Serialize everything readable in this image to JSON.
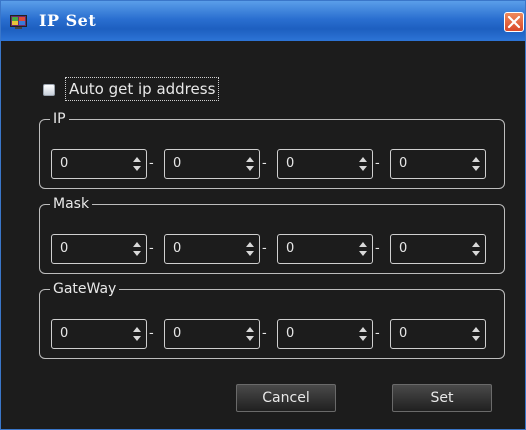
{
  "window": {
    "title": "IP Set",
    "icon": "app-icon",
    "close_icon": "close-icon"
  },
  "auto_ip": {
    "label": "Auto get ip address",
    "checked": false
  },
  "groups": [
    {
      "id": "ip",
      "title": "IP",
      "octets": [
        "0",
        "0",
        "0",
        "0"
      ]
    },
    {
      "id": "mask",
      "title": "Mask",
      "octets": [
        "0",
        "0",
        "0",
        "0"
      ]
    },
    {
      "id": "gateway",
      "title": "GateWay",
      "octets": [
        "0",
        "0",
        "0",
        "0"
      ]
    }
  ],
  "separator": "-",
  "buttons": {
    "cancel": "Cancel",
    "set": "Set"
  },
  "colors": {
    "titlebar": "#2a6fd0",
    "window_bg": "#1c1c1c",
    "close": "#e0532f"
  }
}
